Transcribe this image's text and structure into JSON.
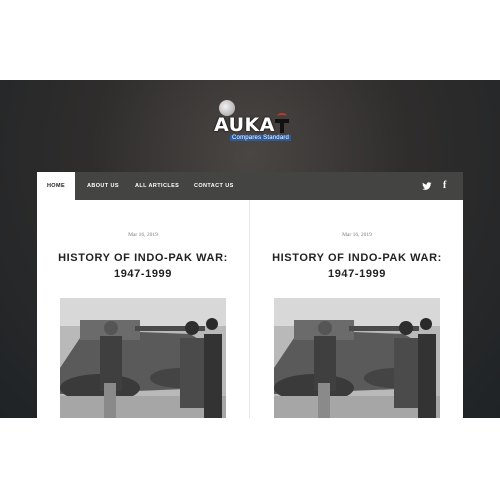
{
  "logo": {
    "text": "AUKA",
    "subtitle": "Compares Standard",
    "icon": "soldier-helmet-icon"
  },
  "nav": {
    "items": [
      "HOME",
      "ABOUT US",
      "ALL ARTICLES",
      "CONTACT US"
    ],
    "active": "HOME",
    "social": [
      "twitter-icon",
      "facebook-icon"
    ],
    "facebook_glyph": "f"
  },
  "articles": [
    {
      "date": "Mar 16, 2019",
      "title": "HISTORY OF INDO-PAK WAR: 1947-1999",
      "image": "tank-soldiers-photo"
    },
    {
      "date": "Mar 16, 2019",
      "title": "HISTORY OF INDO-PAK WAR: 1947-1999",
      "image": "tank-soldiers-photo"
    }
  ],
  "colors": {
    "background": "#2f2d2c",
    "nav_bar": "#444443",
    "accent_blue": "#2c5aa0",
    "accent_red": "#c0392b"
  }
}
